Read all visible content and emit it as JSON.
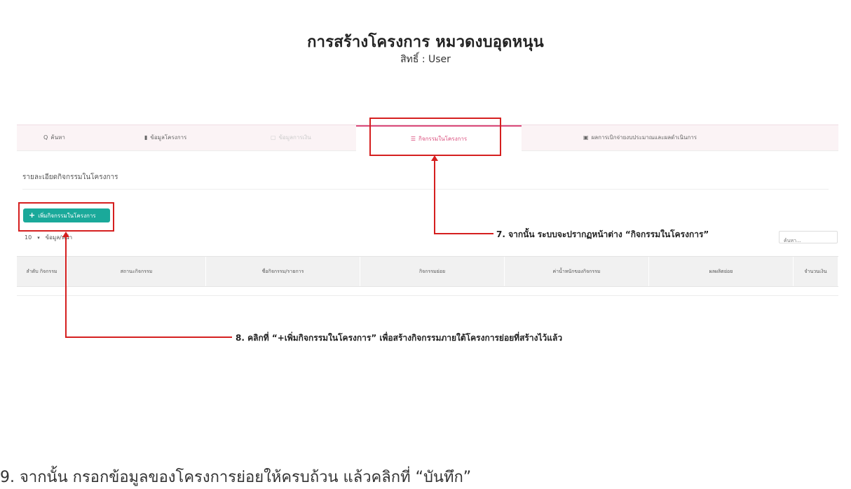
{
  "document": {
    "title": "การสร้างโครงการ หมวดงบอุดหนุน",
    "subtitle": "สิทธิ์ : User"
  },
  "screenshot": {
    "tabs": [
      {
        "icon": "search-icon",
        "glyph": "Q",
        "label": "ค้นหา"
      },
      {
        "icon": "document-icon",
        "glyph": "▮",
        "label": "ข้อมูลโครงการ"
      },
      {
        "icon": "table-icon",
        "glyph": "▢",
        "label": "ข้อมูลการเงิน"
      },
      {
        "icon": "list-icon",
        "glyph": "☰",
        "label": "กิจกรรมในโครงการ"
      },
      {
        "icon": "report-icon",
        "glyph": "▣",
        "label": "ผลการเบิกจ่ายงบประมาณและผลดำเนินการ"
      }
    ],
    "section_heading": "รายละเอียดกิจกรรมในโครงการ",
    "add_button": {
      "plus": "+",
      "label": "เพิ่มกิจกรรมในโครงการ"
    },
    "page_size": {
      "value": "10",
      "suffix": "ข้อมูล/หน้า"
    },
    "search": {
      "placeholder": "ค้นหา..."
    },
    "table": {
      "headers": [
        "ลำดับ กิจกรรม",
        "สถานะกิจกรรม",
        "ชื่อกิจกรรม/รายการ",
        "กิจกรรมย่อย",
        "ค่าน้ำหนักของกิจกรรม",
        "ผลผลิตย่อย",
        "จำนวนเงิน"
      ]
    }
  },
  "annotations": {
    "step7": "7. จากนั้น ระบบจะปรากฏหน้าต่าง “กิจกรรมในโครงการ”",
    "step8": "8. คลิกที่ “+เพิ่มกิจกรรมในโครงการ” เพื่อสร้างกิจกรรมภายใต้โครงการย่อยที่สร้างไว้แล้ว",
    "step9": "9. จากนั้น กรอกข้อมูลของโครงการย่อยให้ครบถ้วน แล้วคลิกที่ “บันทึก”"
  },
  "colors": {
    "highlight": "#d51f1f",
    "accent_button": "#1aa99a",
    "active_tab": "#d94a7a"
  }
}
